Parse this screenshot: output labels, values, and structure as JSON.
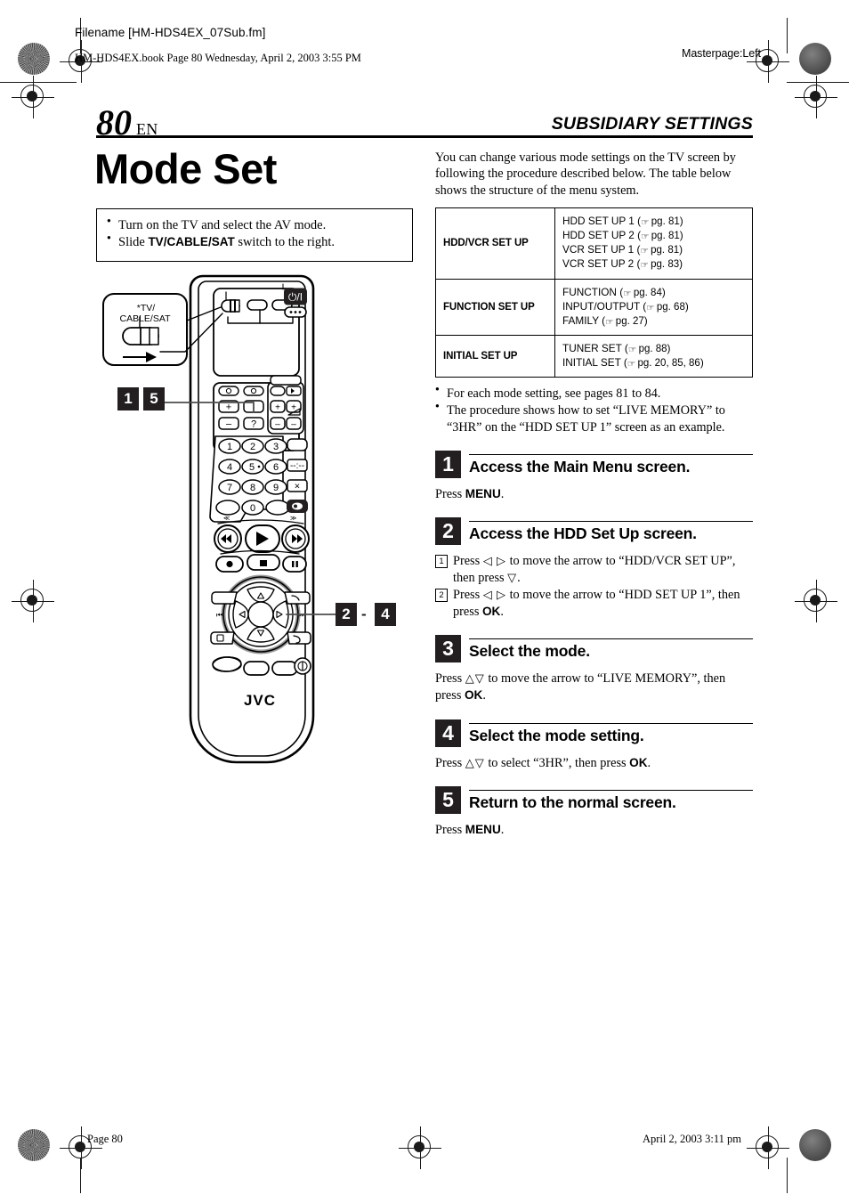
{
  "header": {
    "filename": "Filename [HM-HDS4EX_07Sub.fm]",
    "bookline": "HM-HDS4EX.book  Page 80  Wednesday, April 2, 2003  3:55 PM",
    "masterpage": "Masterpage:Left"
  },
  "page": {
    "number": "80",
    "lang": "EN",
    "section": "SUBSIDIARY SETTINGS",
    "title": "Mode Set"
  },
  "preparation": {
    "items": [
      {
        "pre": "Turn on the TV and select the AV mode.",
        "bold": "",
        "post": ""
      },
      {
        "pre": "Slide ",
        "bold": "TV/CABLE/SAT",
        "post": " switch to the right."
      }
    ]
  },
  "illustration": {
    "switch_label_line1": "*TV/",
    "switch_label_line2": "CABLE/SAT",
    "brand": "JVC",
    "callout_top": {
      "chips": [
        "1",
        "5"
      ]
    },
    "callout_bottom": {
      "chip_start": "2",
      "dash": "-",
      "chip_end": "4"
    },
    "keypad": [
      "1",
      "2",
      "3",
      "4",
      "5",
      "6",
      "7",
      "8",
      "9",
      "0"
    ],
    "key_five_label": "5",
    "help_key": "?",
    "plus_label": "+",
    "minus_label": "−",
    "power_label": "⏻/I",
    "close_label": "×"
  },
  "intro": {
    "lines": [
      "You can change various mode settings on the TV screen",
      "by following the procedure described below.",
      "The table below shows the structure of the menu system."
    ]
  },
  "menu_table": {
    "rows": [
      {
        "category": "HDD/VCR SET UP",
        "items": [
          {
            "name": "HDD SET UP 1",
            "ref": "pg. 81"
          },
          {
            "name": "HDD SET UP 2",
            "ref": "pg. 81"
          },
          {
            "name": "VCR SET UP 1",
            "ref": "pg. 81"
          },
          {
            "name": "VCR SET UP 2",
            "ref": "pg. 83"
          }
        ]
      },
      {
        "category": "FUNCTION SET UP",
        "items": [
          {
            "name": "FUNCTION",
            "ref": "pg. 84"
          },
          {
            "name": "INPUT/OUTPUT",
            "ref": "pg. 68"
          },
          {
            "name": "FAMILY",
            "ref": "pg. 27"
          }
        ]
      },
      {
        "category": "INITIAL SET UP",
        "items": [
          {
            "name": "TUNER SET",
            "ref": "pg. 88"
          },
          {
            "name": "INITIAL SET",
            "ref": "pg. 20, 85, 86"
          }
        ]
      }
    ]
  },
  "notes": {
    "items": [
      "For each mode setting, see pages 81 to 84.",
      "The procedure shows how to set “LIVE MEMORY” to “3HR” on the “HDD SET UP 1” screen as an example."
    ]
  },
  "steps": [
    {
      "num": "1",
      "title": "Access the Main Menu screen.",
      "body_pre": "Press ",
      "body_bold": "MENU",
      "body_post": "."
    },
    {
      "num": "2",
      "title": "Access the HDD Set Up screen.",
      "sub": [
        {
          "marker": "1",
          "pre": "Press ",
          "glyph": "◁ ▷",
          "mid": " to move the arrow to “HDD/VCR SET UP”, then press ",
          "glyph2": "▽",
          "post": "."
        },
        {
          "marker": "2",
          "pre": "Press ",
          "glyph": "◁ ▷",
          "mid": " to move the arrow to “HDD SET UP 1”, then press ",
          "bold": "OK",
          "post": "."
        }
      ]
    },
    {
      "num": "3",
      "title": "Select the mode.",
      "body_pre": "Press ",
      "body_glyph": "△▽",
      "body_mid": " to move the arrow to “LIVE MEMORY”, then press ",
      "body_bold": "OK",
      "body_post": "."
    },
    {
      "num": "4",
      "title": "Select the mode setting.",
      "body_pre": "Press ",
      "body_glyph": "△▽",
      "body_mid": " to select “3HR”, then press ",
      "body_bold": "OK",
      "body_post": "."
    },
    {
      "num": "5",
      "title": "Return to the normal screen.",
      "body_pre": "Press ",
      "body_bold": "MENU",
      "body_post": "."
    }
  ],
  "footer": {
    "left": "Page 80",
    "right": "April 2, 2003 3:11 pm"
  }
}
